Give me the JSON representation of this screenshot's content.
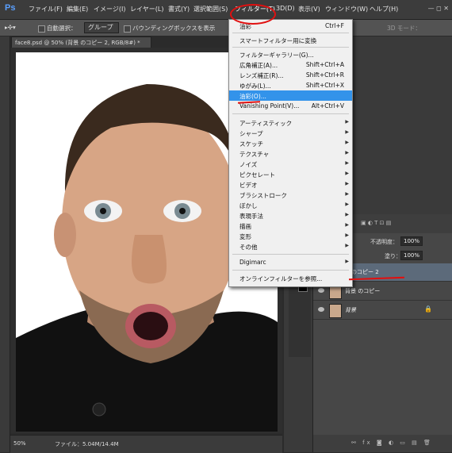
{
  "app": {
    "logo": "Ps"
  },
  "menubar": {
    "items": [
      "ファイル(F)",
      "編集(E)",
      "イメージ(I)",
      "レイヤー(L)",
      "書式(Y)",
      "選択範囲(S)",
      "フィルター(T)",
      "3D(D)",
      "表示(V)",
      "ウィンドウ(W)",
      "ヘルプ(H)"
    ],
    "window_controls": "—  ◻  ✕"
  },
  "options": {
    "auto_select_label": "自動選択：",
    "auto_select_value": "グループ",
    "bounding_box_label": "バウンディングボックスを表示",
    "mode_3d_label": "3D モード："
  },
  "document": {
    "tab_title": "face8.psd @ 50% (背景 のコピー 2, RGB/8#) *"
  },
  "status": {
    "zoom": "50%",
    "file_info": "ファイル：5.04M/14.4M"
  },
  "filter_menu": {
    "items": [
      {
        "label": "油彩",
        "shortcut": "Ctrl+F"
      },
      {
        "label": "スマートフィルター用に変換",
        "shortcut": ""
      },
      {
        "label": "フィルターギャラリー(G)...",
        "shortcut": ""
      },
      {
        "label": "広角補正(A)...",
        "shortcut": "Shift+Ctrl+A"
      },
      {
        "label": "レンズ補正(R)...",
        "shortcut": "Shift+Ctrl+R"
      },
      {
        "label": "ゆがみ(L)...",
        "shortcut": "Shift+Ctrl+X"
      },
      {
        "label": "油彩(O)...",
        "shortcut": ""
      },
      {
        "label": "Vanishing Point(V)...",
        "shortcut": "Alt+Ctrl+V"
      },
      {
        "label": "アーティスティック"
      },
      {
        "label": "シャープ"
      },
      {
        "label": "スケッチ"
      },
      {
        "label": "テクスチャ"
      },
      {
        "label": "ノイズ"
      },
      {
        "label": "ピクセレート"
      },
      {
        "label": "ビデオ"
      },
      {
        "label": "ブラシストローク"
      },
      {
        "label": "ぼかし"
      },
      {
        "label": "表現手法"
      },
      {
        "label": "描画"
      },
      {
        "label": "変形"
      },
      {
        "label": "その他"
      },
      {
        "label": "Digimarc"
      },
      {
        "label": "オンラインフィルターを参照..."
      }
    ]
  },
  "layers": {
    "opacity_label": "不透明度：",
    "opacity_value": "100%",
    "fill_label": "塗り：",
    "fill_value": "100%",
    "items": [
      {
        "name": "のコピー 2"
      },
      {
        "name": "背景 のコピー"
      },
      {
        "name": "背景"
      }
    ]
  },
  "colors": {
    "menu_highlight": "#3393ea",
    "annotation_red": "#e01010"
  }
}
